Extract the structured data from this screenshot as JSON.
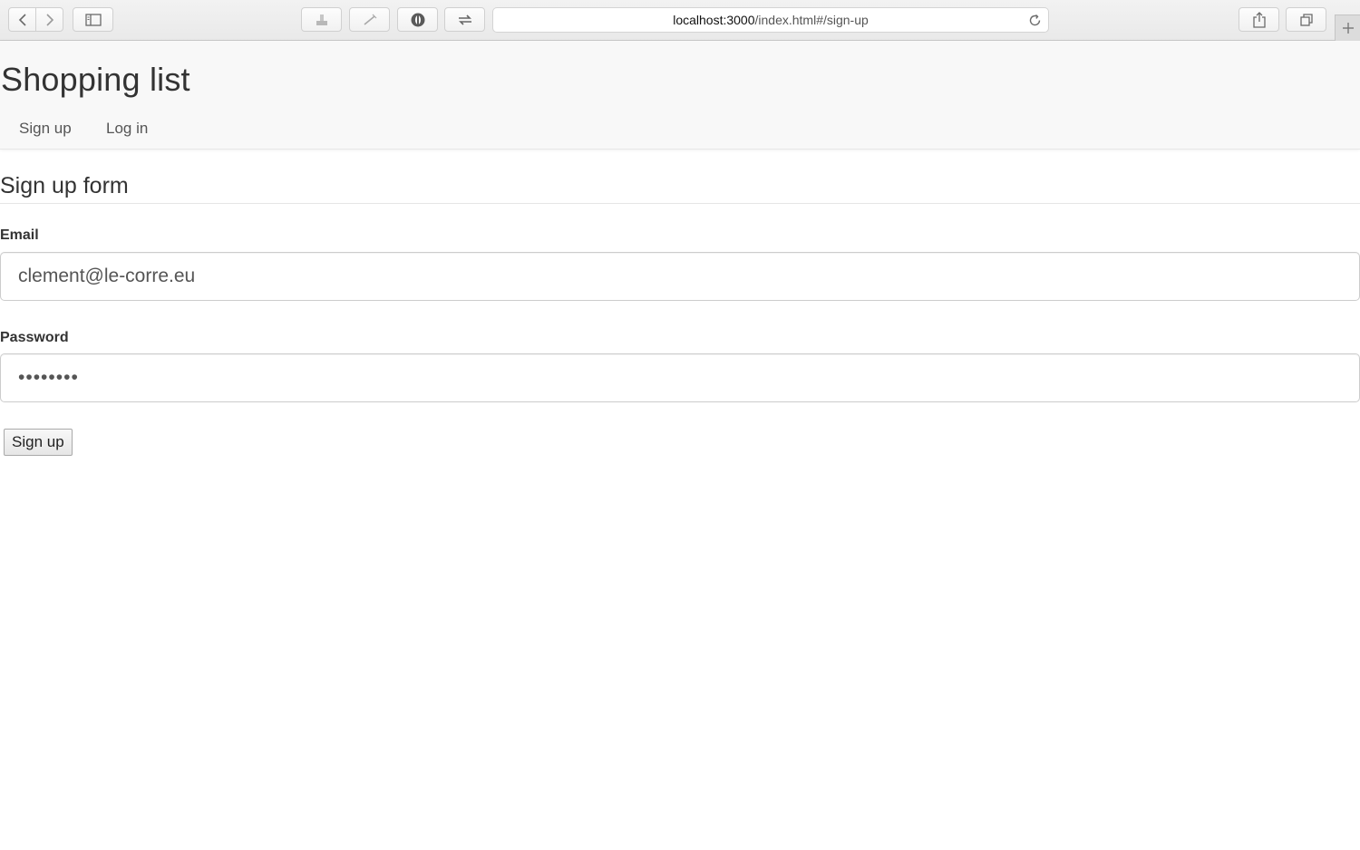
{
  "browser": {
    "url_host": "localhost:3000",
    "url_path": "/index.html#/sign-up",
    "icons": {
      "back": "chevron-left-icon",
      "forward": "chevron-right-icon",
      "sidebar": "sidebar-icon",
      "reload": "reload-icon",
      "share": "share-icon",
      "tabs": "tabs-icon",
      "new_tab": "plus-icon"
    }
  },
  "header": {
    "title": "Shopping list",
    "nav": [
      {
        "label": "Sign up"
      },
      {
        "label": "Log in"
      }
    ]
  },
  "form": {
    "heading": "Sign up form",
    "email": {
      "label": "Email",
      "value": "clement@le-corre.eu"
    },
    "password": {
      "label": "Password",
      "value": "********"
    },
    "submit_label": "Sign up"
  },
  "colors": {
    "header_bg": "#f8f8f8",
    "text": "#333333",
    "nav_text": "#555555",
    "input_border": "#cccccc"
  }
}
